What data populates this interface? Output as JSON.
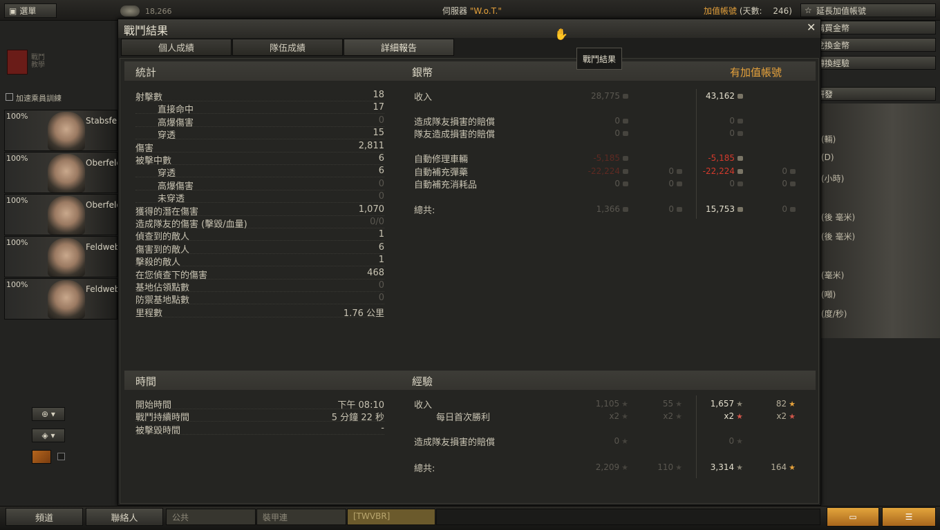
{
  "topbar": {
    "menu_label": "選單",
    "credits_count": "18,266",
    "server_prefix": "伺服器",
    "server_name": "\"W.o.T.\"",
    "premium_label": "加值帳號",
    "days_label": "(天數:",
    "days_value": "246)",
    "extend_premium": "延長加值帳號"
  },
  "right_menu": [
    "購買金幣",
    "兌換金幣",
    "轉換經驗",
    "研發"
  ],
  "right_stats": [
    "(輛)",
    "(D)",
    "(小時)",
    "(後 毫米)",
    "(後 毫米)",
    "(毫米)",
    "(噸)",
    "(度/秒)"
  ],
  "left_panel": {
    "tutorial_label": "戰鬥教學",
    "accel_training": "加速乘員訓練",
    "crew": [
      {
        "pct": "100%",
        "name": "Stabsfel"
      },
      {
        "pct": "100%",
        "name": "Oberfeld"
      },
      {
        "pct": "100%",
        "name": "Oberfeld"
      },
      {
        "pct": "100%",
        "name": "Feldwebe"
      },
      {
        "pct": "100%",
        "name": "Feldwebe"
      }
    ]
  },
  "window": {
    "title": "戰鬥結果",
    "tabs": [
      "個人成績",
      "隊伍成績",
      "詳細報告"
    ],
    "tooltip": "戰鬥結果"
  },
  "stats": {
    "header": "統計",
    "rows": [
      {
        "label": "射擊數",
        "value": "18",
        "indent": false,
        "dim": false
      },
      {
        "label": "直接命中",
        "value": "17",
        "indent": true,
        "dim": false
      },
      {
        "label": "高爆傷害",
        "value": "0",
        "indent": true,
        "dim": true
      },
      {
        "label": "穿透",
        "value": "15",
        "indent": true,
        "dim": false
      },
      {
        "label": "傷害",
        "value": "2,811",
        "indent": false,
        "dim": false
      },
      {
        "label": "被擊中數",
        "value": "6",
        "indent": false,
        "dim": false
      },
      {
        "label": "穿透",
        "value": "6",
        "indent": true,
        "dim": false
      },
      {
        "label": "高爆傷害",
        "value": "0",
        "indent": true,
        "dim": true
      },
      {
        "label": "未穿透",
        "value": "0",
        "indent": true,
        "dim": true
      },
      {
        "label": "獲得的潛在傷害",
        "value": "1,070",
        "indent": false,
        "dim": false
      },
      {
        "label": "造成隊友的傷害 (擊毀/血量)",
        "value": "0/0",
        "indent": false,
        "dim": true
      },
      {
        "label": "偵查到的敵人",
        "value": "1",
        "indent": false,
        "dim": false
      },
      {
        "label": "傷害到的敵人",
        "value": "6",
        "indent": false,
        "dim": false
      },
      {
        "label": "擊殺的敵人",
        "value": "1",
        "indent": false,
        "dim": false
      },
      {
        "label": "在您偵查下的傷害",
        "value": "468",
        "indent": false,
        "dim": false
      },
      {
        "label": "基地佔領點數",
        "value": "0",
        "indent": false,
        "dim": true
      },
      {
        "label": "防禦基地點數",
        "value": "0",
        "indent": false,
        "dim": true
      },
      {
        "label": "里程數",
        "value": "1.76 公里",
        "indent": false,
        "dim": false
      }
    ]
  },
  "credits": {
    "header": "銀幣",
    "premium_header": "有加值帳號",
    "rows": [
      {
        "label": "收入",
        "base": "28,775",
        "base_gold": "",
        "prem": "43,162",
        "prem_gold": ""
      },
      {
        "label": "造成隊友損害的賠償",
        "base": "0",
        "base_gold": "",
        "prem": "0",
        "prem_gold": ""
      },
      {
        "label": "隊友造成損害的賠償",
        "base": "0",
        "base_gold": "",
        "prem": "0",
        "prem_gold": ""
      },
      {
        "label": "自動修理車輛",
        "base": "-5,185",
        "base_gold": "",
        "prem": "-5,185",
        "prem_gold": ""
      },
      {
        "label": "自動補充彈藥",
        "base": "-22,224",
        "base_gold": "0",
        "prem": "-22,224",
        "prem_gold": "0"
      },
      {
        "label": "自動補充消耗品",
        "base": "0",
        "base_gold": "0",
        "prem": "0",
        "prem_gold": "0"
      },
      {
        "label": "總共:",
        "base": "1,366",
        "base_gold": "0",
        "prem": "15,753",
        "prem_gold": "0"
      }
    ]
  },
  "time": {
    "header": "時間",
    "rows": [
      {
        "label": "開始時間",
        "value": "下午 08:10"
      },
      {
        "label": "戰鬥持續時間",
        "value": "5 分鐘 22 秒"
      },
      {
        "label": "被擊毀時間",
        "value": "-"
      }
    ]
  },
  "experience": {
    "header": "經驗",
    "rows": [
      {
        "label": "收入",
        "base": "1,105",
        "base_free": "55",
        "prem": "1,657",
        "prem_free": "82"
      },
      {
        "label": "每日首次勝利",
        "base": "x2",
        "base_free": "x2",
        "prem": "x2",
        "prem_free": "x2"
      },
      {
        "label": "造成隊友損害的賠償",
        "base": "0",
        "base_free": "",
        "prem": "0",
        "prem_free": ""
      },
      {
        "label": "總共:",
        "base": "2,209",
        "base_free": "110",
        "prem": "3,314",
        "prem_free": "164"
      }
    ]
  },
  "bottom": {
    "channels_button": "頻道",
    "contacts_button": "聯絡人",
    "chat_tabs": [
      "公共",
      "裝甲連",
      "[TWVBR]"
    ]
  },
  "colors": {
    "gold": "#e6a23c",
    "red": "#d43a2c"
  }
}
